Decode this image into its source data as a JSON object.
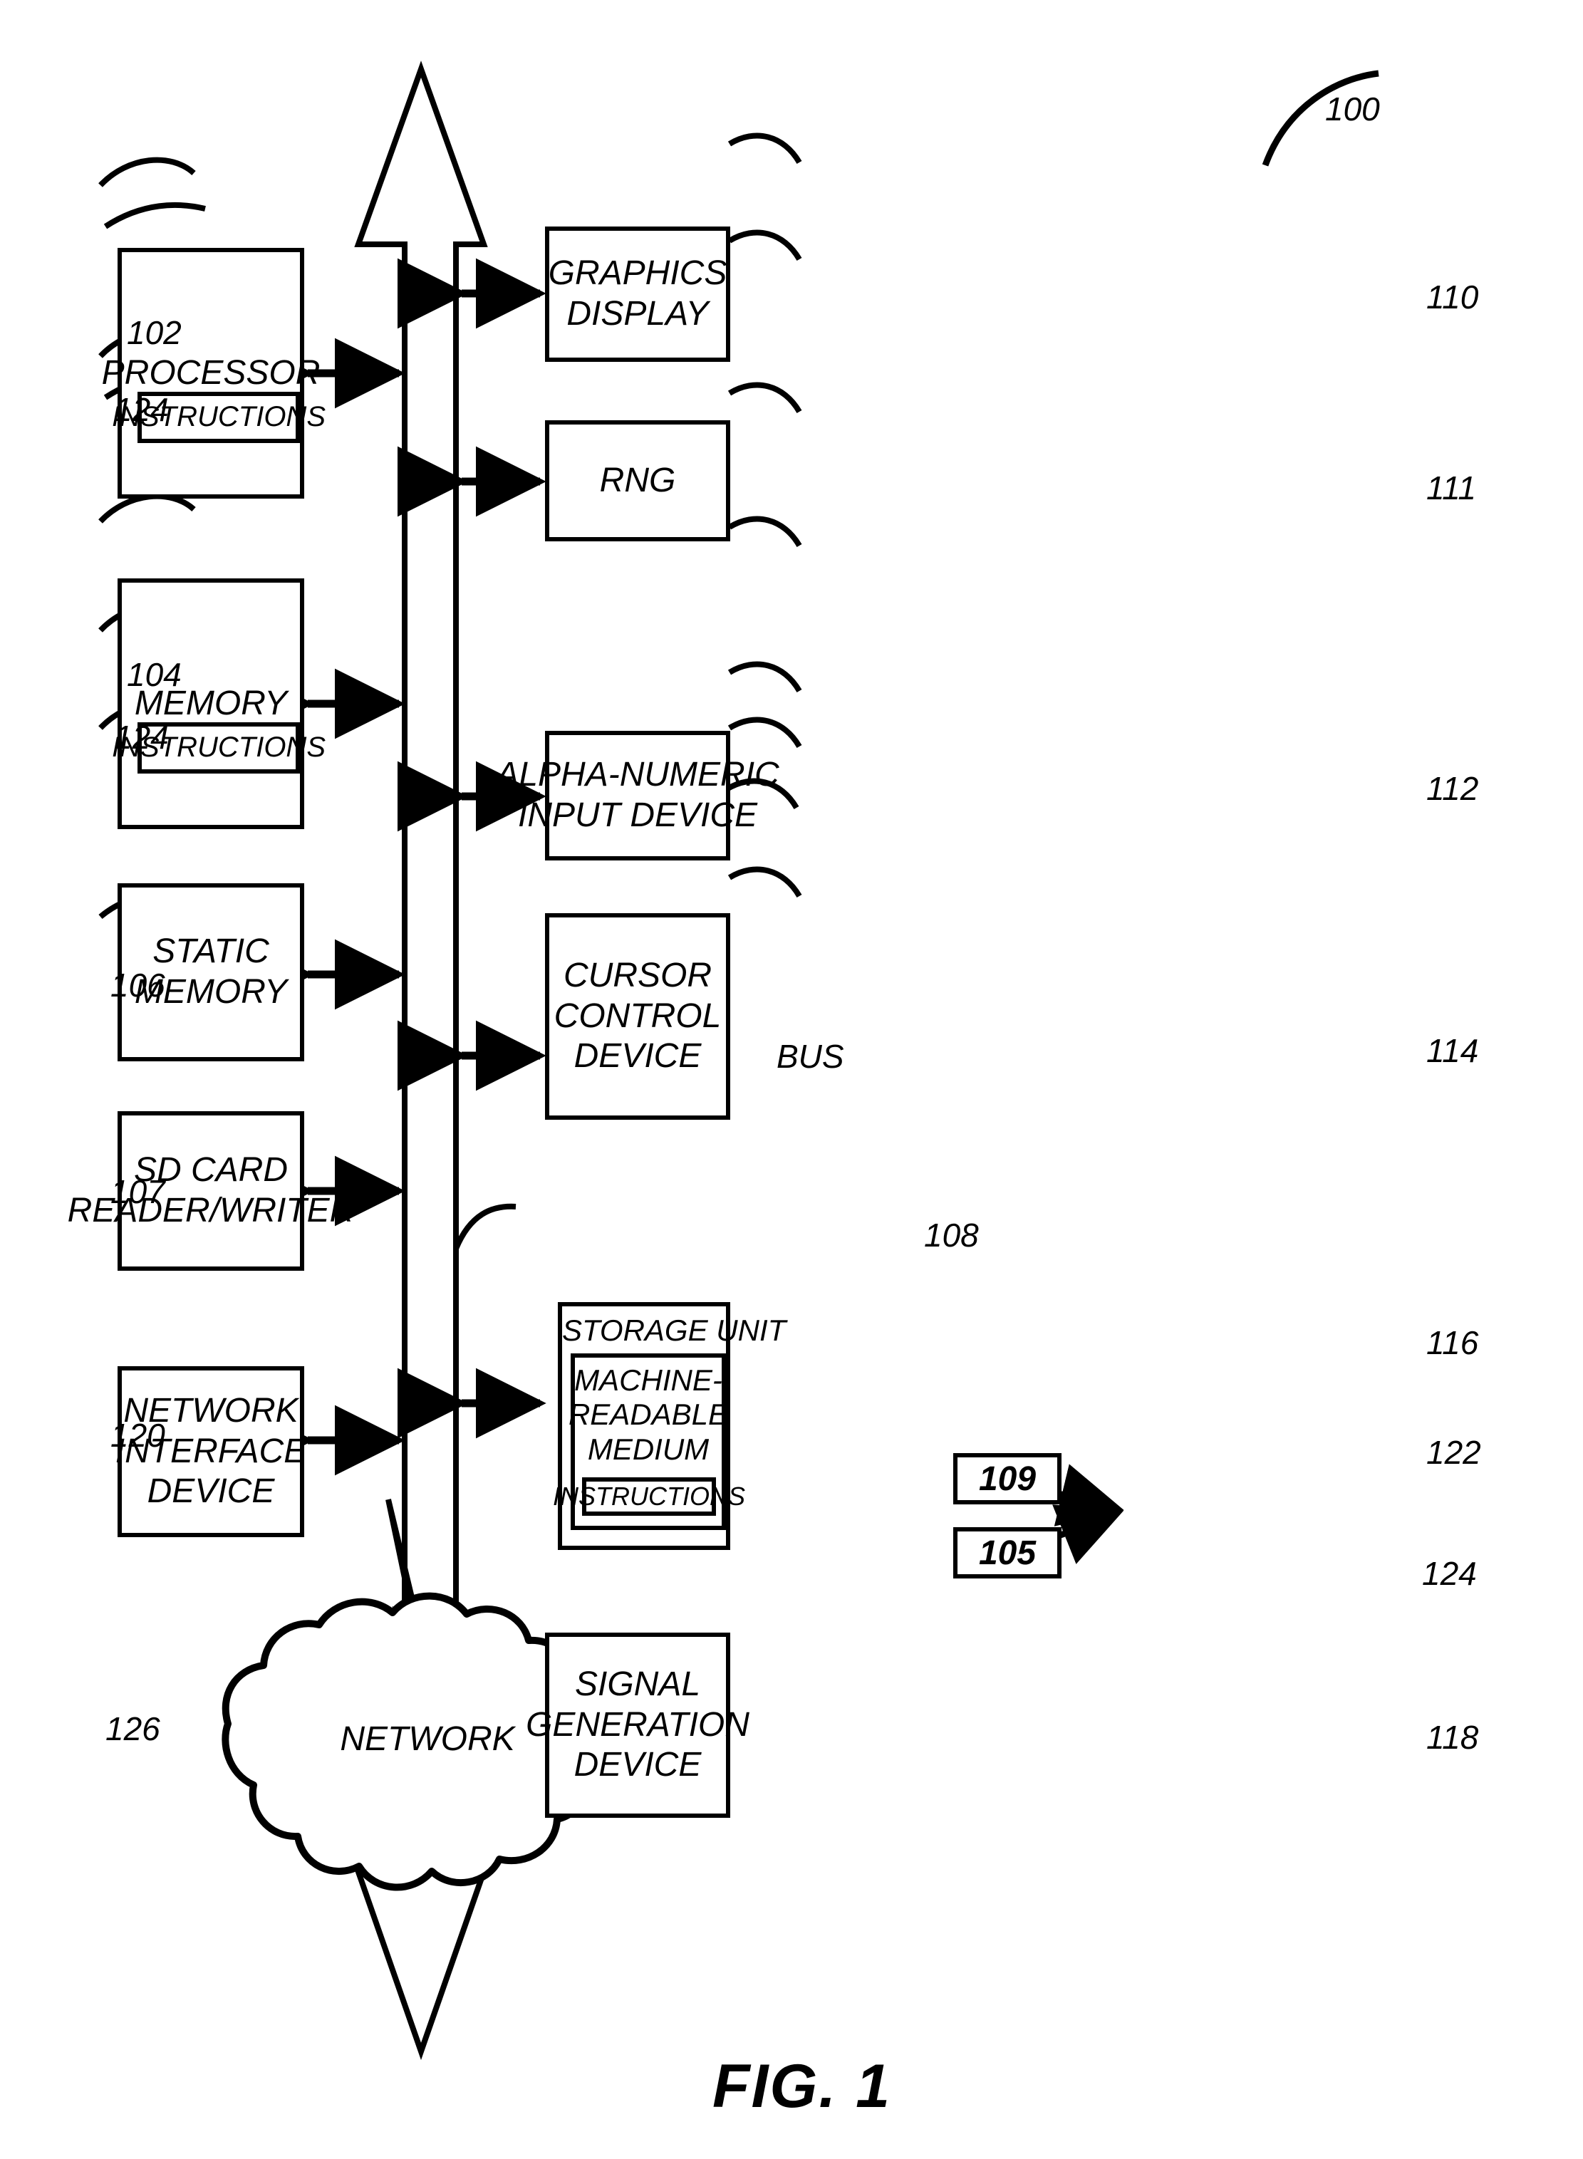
{
  "figure": {
    "caption": "FIG. 1",
    "system_ref": "100",
    "bus_label": "BUS",
    "bus_ref": "108"
  },
  "left_column": [
    {
      "id": "processor",
      "lines": [
        "PROCESSOR"
      ],
      "ref": "102",
      "inner": {
        "id": "processor-instructions",
        "label": "INSTRUCTIONS",
        "ref": "124"
      }
    },
    {
      "id": "memory",
      "lines": [
        "MEMORY"
      ],
      "ref": "104",
      "inner": {
        "id": "memory-instructions",
        "label": "INSTRUCTIONS",
        "ref": "124"
      }
    },
    {
      "id": "static-memory",
      "lines": [
        "STATIC",
        "MEMORY"
      ],
      "ref": "106",
      "inner": null
    },
    {
      "id": "sd-card-reader-writer",
      "lines": [
        "SD CARD",
        "READER/WRITER"
      ],
      "ref": "107",
      "inner": null
    },
    {
      "id": "network-interface-device",
      "lines": [
        "NETWORK",
        "INTERFACE",
        "DEVICE"
      ],
      "ref": "120",
      "inner": null
    }
  ],
  "right_column": [
    {
      "id": "graphics-display",
      "lines": [
        "GRAPHICS",
        "DISPLAY"
      ],
      "ref": "110"
    },
    {
      "id": "rng",
      "lines": [
        "RNG"
      ],
      "ref": "111"
    },
    {
      "id": "alpha-numeric-input-device",
      "lines": [
        "ALPHA-NUMERIC",
        "INPUT DEVICE"
      ],
      "ref": "112"
    },
    {
      "id": "cursor-control-device",
      "lines": [
        "CURSOR",
        "CONTROL",
        "DEVICE"
      ],
      "ref": "114"
    },
    {
      "id": "signal-generation-device",
      "lines": [
        "SIGNAL",
        "GENERATION",
        "DEVICE"
      ],
      "ref": "118"
    }
  ],
  "storage_unit": {
    "id": "storage-unit",
    "title": "STORAGE UNIT",
    "ref": "116",
    "medium": {
      "id": "machine-readable-medium",
      "lines": [
        "MACHINE-",
        "READABLE",
        "MEDIUM"
      ],
      "ref": "122",
      "instructions": {
        "label": "INSTRUCTIONS",
        "ref": "124"
      }
    },
    "annotations": [
      {
        "id": "annotation-109",
        "value": "109"
      },
      {
        "id": "annotation-105",
        "value": "105"
      }
    ]
  },
  "network": {
    "id": "network-cloud",
    "label": "NETWORK",
    "ref": "126"
  },
  "colors": {
    "ink": "#000000",
    "paper": "#ffffff"
  }
}
